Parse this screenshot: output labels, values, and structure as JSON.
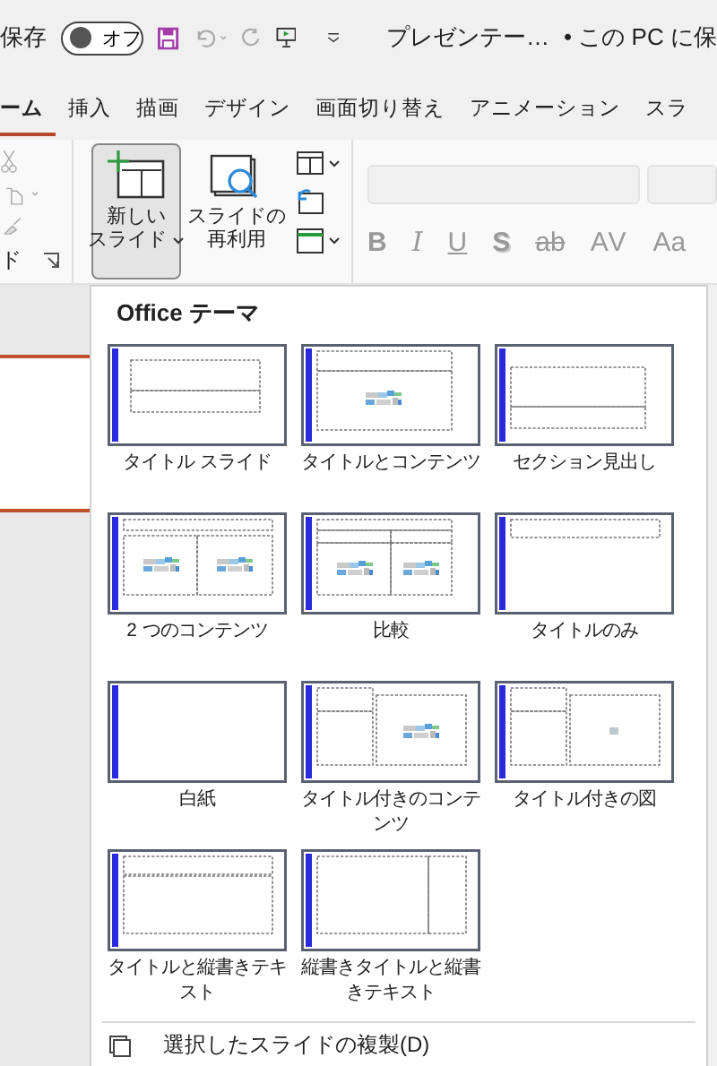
{
  "title_bar": {
    "autosave_label": "保存",
    "autosave": {
      "label": "オフ",
      "on": false
    },
    "document_title": "プレゼンテー…",
    "save_location": "• この PC に保"
  },
  "tabs": [
    {
      "label": "ーム",
      "selected": true
    },
    {
      "label": "挿入",
      "selected": false
    },
    {
      "label": "描画",
      "selected": false
    },
    {
      "label": "デザイン",
      "selected": false
    },
    {
      "label": "画面切り替え",
      "selected": false
    },
    {
      "label": "アニメーション",
      "selected": false
    },
    {
      "label": "スラ",
      "selected": false
    }
  ],
  "ribbon": {
    "clipboard_label": "ド",
    "new_slide": {
      "label_lines": [
        "新しい",
        "スライド"
      ],
      "pressed": true
    },
    "reuse_slides": {
      "label_lines": [
        "スライドの",
        "再利用"
      ]
    },
    "font_buttons": [
      {
        "label": "B",
        "kind": "bold"
      },
      {
        "label": "I",
        "kind": "italic"
      },
      {
        "label": "U",
        "kind": "underline"
      },
      {
        "label": "S",
        "kind": "shadow"
      },
      {
        "label": "ab",
        "kind": "strike"
      },
      {
        "label": "AV",
        "kind": "spacing"
      },
      {
        "label": "Aa",
        "kind": "case"
      }
    ]
  },
  "gallery": {
    "heading": "Office テーマ",
    "layouts": [
      {
        "label": "タイトル スライド",
        "kind": "title"
      },
      {
        "label": "タイトルとコンテンツ",
        "kind": "title-content"
      },
      {
        "label": "セクション見出し",
        "kind": "section"
      },
      {
        "label": "2 つのコンテンツ",
        "kind": "two-content"
      },
      {
        "label": "比較",
        "kind": "comparison"
      },
      {
        "label": "タイトルのみ",
        "kind": "title-only"
      },
      {
        "label": "白紙",
        "kind": "blank"
      },
      {
        "label": "タイトル付きのコンテンツ",
        "kind": "content-caption"
      },
      {
        "label": "タイトル付きの図",
        "kind": "picture-caption"
      },
      {
        "label": "タイトルと縦書きテキスト",
        "kind": "vertical-text"
      },
      {
        "label": "縦書きタイトルと縦書きテキスト",
        "kind": "vertical-title"
      }
    ]
  },
  "menu_items": [
    "選択したスライドの複製(D)"
  ]
}
